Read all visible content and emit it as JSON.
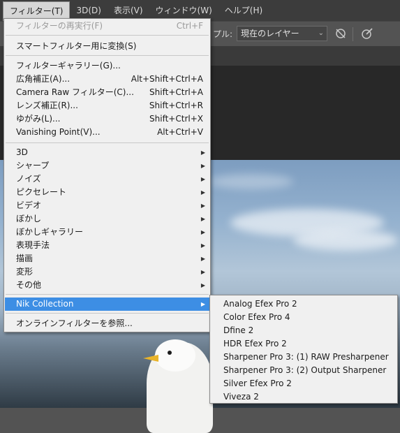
{
  "menubar": {
    "items": [
      "フィルター(T)",
      "3D(D)",
      "表示(V)",
      "ウィンドウ(W)",
      "ヘルプ(H)"
    ]
  },
  "options_bar": {
    "sample_label": "プル:",
    "sample_value": "現在のレイヤー",
    "icons": [
      "ignore-adjustment-icon",
      "brush-pressure-icon"
    ]
  },
  "filter_menu": {
    "last_filter": {
      "label": "フィルターの再実行(F)",
      "shortcut": "Ctrl+F"
    },
    "convert_smart": "スマートフィルター用に変換(S)",
    "group1": [
      {
        "label": "フィルターギャラリー(G)...",
        "shortcut": ""
      },
      {
        "label": "広角補正(A)...",
        "shortcut": "Alt+Shift+Ctrl+A"
      },
      {
        "label": "Camera Raw フィルター(C)...",
        "shortcut": "Shift+Ctrl+A"
      },
      {
        "label": "レンズ補正(R)...",
        "shortcut": "Shift+Ctrl+R"
      },
      {
        "label": "ゆがみ(L)...",
        "shortcut": "Shift+Ctrl+X"
      },
      {
        "label": "Vanishing Point(V)...",
        "shortcut": "Alt+Ctrl+V"
      }
    ],
    "submenus": [
      "3D",
      "シャープ",
      "ノイズ",
      "ピクセレート",
      "ビデオ",
      "ぼかし",
      "ぼかしギャラリー",
      "表現手法",
      "描画",
      "変形",
      "その他"
    ],
    "nik": "Nik Collection",
    "browse": "オンラインフィルターを参照..."
  },
  "nik_submenu": {
    "items": [
      "Analog Efex Pro 2",
      "Color Efex Pro 4",
      "Dfine 2",
      "HDR Efex Pro 2",
      "Sharpener Pro 3: (1) RAW Presharpener",
      "Sharpener Pro 3: (2) Output Sharpener",
      "Silver Efex Pro 2",
      "Viveza 2"
    ]
  },
  "colors": {
    "highlight": "#3d8ee4",
    "menu_bg": "#f0f0f0",
    "app_bar": "#3c3c3c"
  }
}
